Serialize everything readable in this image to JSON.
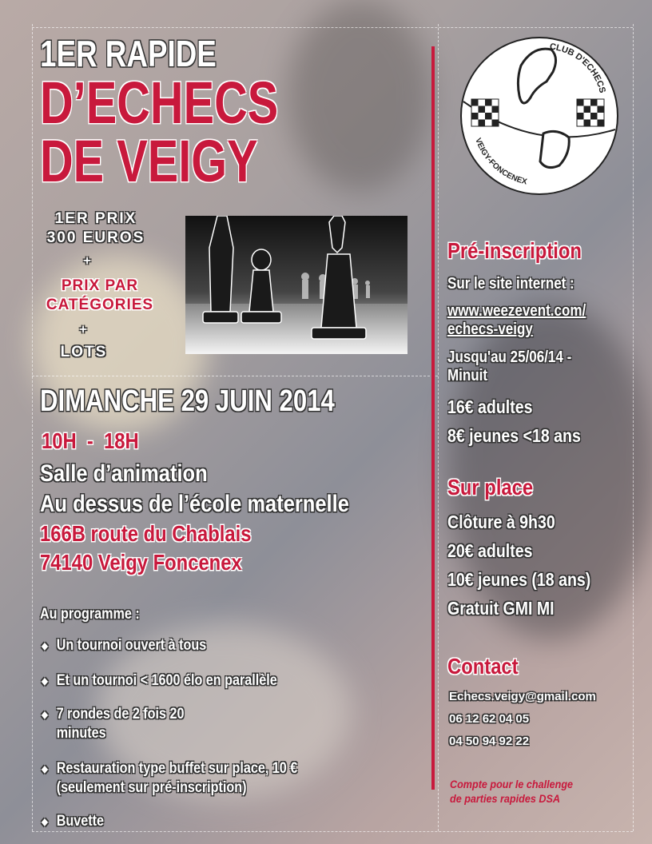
{
  "title": {
    "line1": "1ER RAPIDE",
    "line2": "D’ECHECS",
    "line3": "DE VEIGY"
  },
  "prizes": {
    "first_prize_line1": "1ER PRIX",
    "first_prize_line2": "300 EUROS",
    "plus1": "+",
    "category_line1": "PRIX PAR",
    "category_line2": "CATÉGORIES",
    "plus2": "+",
    "lots": "LOTS"
  },
  "event": {
    "date": "DIMANCHE 29 JUIN 2014",
    "hours": "10H  -  18H",
    "venue_line1": "Salle d’animation",
    "venue_line2": "Au dessus de l’école maternelle",
    "address_line1": "166B route du Chablais",
    "address_line2": "74140 Veigy Foncenex"
  },
  "programme": {
    "title": "Au programme :",
    "items": [
      {
        "line1": "Un tournoi ouvert à tous",
        "line2": ""
      },
      {
        "line1": "Et un tournoi < 1600 élo en parallèle",
        "line2": ""
      },
      {
        "line1": "7 rondes de 2 fois 20",
        "line2": "minutes"
      },
      {
        "line1": "Restauration type buffet sur place, 10 €",
        "line2": "(seulement sur pré-inscription)"
      },
      {
        "line1": "Buvette",
        "line2": ""
      }
    ]
  },
  "logo": {
    "club_name": "CLUB D'ECHECS",
    "town": "VEIGY-FONCENEX"
  },
  "preinscription": {
    "title": "Pré-inscription",
    "line1": "Sur le site internet :",
    "url_line1": "www.weezevent.com/",
    "url_line2": "echecs-veigy",
    "deadline_line1": "Jusqu'au 25/06/14 -",
    "deadline_line2": "Minuit",
    "price_adults": "16€  adultes",
    "price_youth": "8€ jeunes <18 ans"
  },
  "onsite": {
    "title": "Sur place",
    "closing": "Clôture à 9h30",
    "price_adults": "20€  adultes",
    "price_youth": "10€ jeunes (18 ans)",
    "free": "Gratuit GMI MI"
  },
  "contact": {
    "title": "Contact",
    "email": "Echecs.veigy@gmail.com",
    "phone1": "06 12 62 04 05",
    "phone2": "04 50 94 92 22"
  },
  "note": {
    "line1": "Compte pour le challenge",
    "line2": "de parties rapides DSA"
  },
  "colors": {
    "accent_red": "#c8193c",
    "text_white": "#ffffff"
  }
}
